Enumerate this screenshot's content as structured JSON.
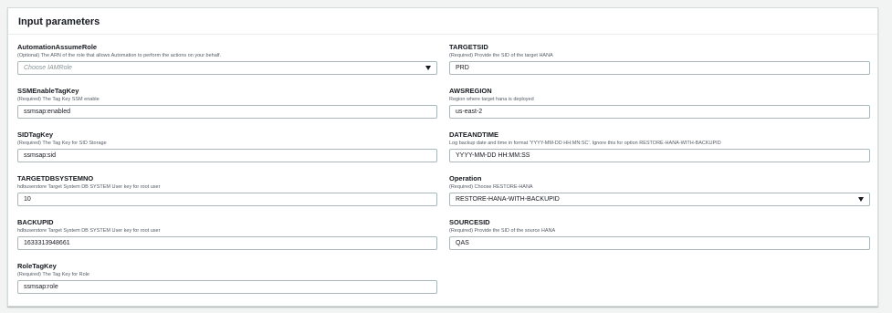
{
  "panel": {
    "title": "Input parameters"
  },
  "left": [
    {
      "label": "AutomationAssumeRole",
      "desc": "(Optional) The ARN of the role that allows Automation to perform the actions on your behalf.",
      "value": "",
      "placeholder": "Choose IAMRole",
      "type": "select"
    },
    {
      "label": "SSMEnableTagKey",
      "desc": "(Required) The Tag Key SSM enable",
      "value": "ssmsap:enabled",
      "type": "text"
    },
    {
      "label": "SIDTagKey",
      "desc": "(Required) The Tag Key for SID Storage",
      "value": "ssmsap:sid",
      "type": "text"
    },
    {
      "label": "TARGETDBSYSTEMNO",
      "desc": "hdbuserstore Target System DB SYSTEM User key for root user",
      "value": "10",
      "type": "text"
    },
    {
      "label": "BACKUPID",
      "desc": "hdbuserstore Target System DB SYSTEM User key for root user",
      "value": "1633313948661",
      "type": "text"
    },
    {
      "label": "RoleTagKey",
      "desc": "(Required) The Tag Key for Role",
      "value": "ssmsap:role",
      "type": "text"
    }
  ],
  "right": [
    {
      "label": "TARGETSID",
      "desc": "(Required) Provide the SID of the target HANA",
      "value": "PRD",
      "type": "text"
    },
    {
      "label": "AWSREGION",
      "desc": "Region where target hana is deployed",
      "value": "us-east-2",
      "type": "text"
    },
    {
      "label": "DATEANDTIME",
      "desc": "Log backup date and time in format 'YYYY-MM-DD HH:MN:SC'. Ignore this for option RESTORE-HANA-WITH-BACKUPID",
      "value": "YYYY-MM-DD HH:MM:SS",
      "type": "text"
    },
    {
      "label": "Operation",
      "desc": "(Required) Choose RESTORE-HANA",
      "value": "RESTORE-HANA-WITH-BACKUPID",
      "type": "select"
    },
    {
      "label": "SOURCESID",
      "desc": "(Required) Provide the SID of the source HANA",
      "value": "QAS",
      "type": "text"
    }
  ]
}
